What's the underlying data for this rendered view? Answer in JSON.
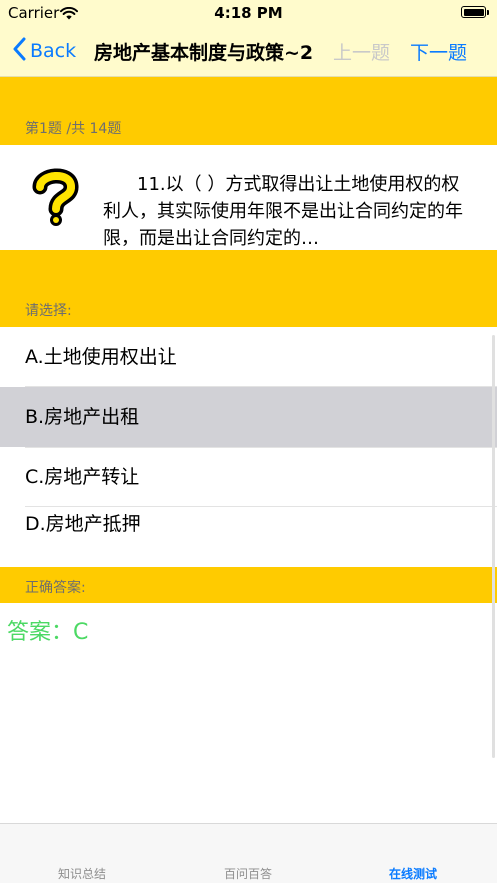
{
  "status_bar": {
    "carrier": "Carrier",
    "time": "4:18 PM"
  },
  "nav": {
    "back_label": "Back",
    "title": "房地产基本制度与政策~2",
    "prev_label": "上一题",
    "next_label": "下一题"
  },
  "progress_label": "第1题 /共 14题",
  "question": {
    "icon": "question-mark-icon",
    "text": "11.以（    ）方式取得出让土地使用权的权利人，其实际使用年限不是出让合同约定的年限，而是出让合同约定的…"
  },
  "choose_label": "请选择:",
  "options": [
    {
      "label": "A.土地使用权出让",
      "selected": false
    },
    {
      "label": "B.房地产出租",
      "selected": true
    },
    {
      "label": "C.房地产转让",
      "selected": false
    },
    {
      "label": "D.房地产抵押",
      "selected": false
    }
  ],
  "correct_label": "正确答案:",
  "answer_text": "答案：C",
  "tabs": [
    {
      "label": "知识总结",
      "active": false
    },
    {
      "label": "百问百答",
      "active": false
    },
    {
      "label": "在线测试",
      "active": true
    }
  ],
  "colors": {
    "accent": "#0a7bff",
    "band": "#ffcb00",
    "bar_background": "#fffbcc",
    "answer": "#4cd964",
    "selected_row": "#d1d1d6"
  }
}
